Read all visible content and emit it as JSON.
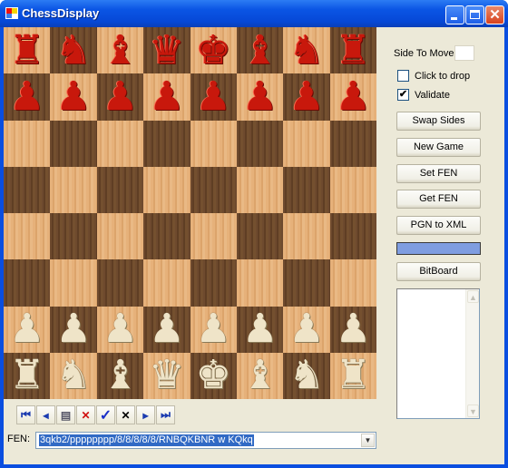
{
  "window": {
    "title": "ChessDisplay",
    "controls": {
      "minimize": "_",
      "maximize": "□",
      "close": "✕"
    }
  },
  "board": {
    "top_left_square": "light",
    "ranks": [
      [
        {
          "piece": "rook",
          "color": "black",
          "glyph": "♜"
        },
        {
          "piece": "knight",
          "color": "black",
          "glyph": "♞"
        },
        {
          "piece": "bishop",
          "color": "black",
          "glyph": "♝"
        },
        {
          "piece": "queen",
          "color": "black",
          "glyph": "♛"
        },
        {
          "piece": "king",
          "color": "black",
          "glyph": "♚"
        },
        {
          "piece": "bishop",
          "color": "black",
          "glyph": "♝"
        },
        {
          "piece": "knight",
          "color": "black",
          "glyph": "♞"
        },
        {
          "piece": "rook",
          "color": "black",
          "glyph": "♜"
        }
      ],
      [
        {
          "piece": "pawn",
          "color": "black",
          "glyph": "♟"
        },
        {
          "piece": "pawn",
          "color": "black",
          "glyph": "♟"
        },
        {
          "piece": "pawn",
          "color": "black",
          "glyph": "♟"
        },
        {
          "piece": "pawn",
          "color": "black",
          "glyph": "♟"
        },
        {
          "piece": "pawn",
          "color": "black",
          "glyph": "♟"
        },
        {
          "piece": "pawn",
          "color": "black",
          "glyph": "♟"
        },
        {
          "piece": "pawn",
          "color": "black",
          "glyph": "♟"
        },
        {
          "piece": "pawn",
          "color": "black",
          "glyph": "♟"
        }
      ],
      [
        null,
        null,
        null,
        null,
        null,
        null,
        null,
        null
      ],
      [
        null,
        null,
        null,
        null,
        null,
        null,
        null,
        null
      ],
      [
        null,
        null,
        null,
        null,
        null,
        null,
        null,
        null
      ],
      [
        null,
        null,
        null,
        null,
        null,
        null,
        null,
        null
      ],
      [
        {
          "piece": "pawn",
          "color": "white",
          "glyph": "♟"
        },
        {
          "piece": "pawn",
          "color": "white",
          "glyph": "♟"
        },
        {
          "piece": "pawn",
          "color": "white",
          "glyph": "♟"
        },
        {
          "piece": "pawn",
          "color": "white",
          "glyph": "♟"
        },
        {
          "piece": "pawn",
          "color": "white",
          "glyph": "♟"
        },
        {
          "piece": "pawn",
          "color": "white",
          "glyph": "♟"
        },
        {
          "piece": "pawn",
          "color": "white",
          "glyph": "♟"
        },
        {
          "piece": "pawn",
          "color": "white",
          "glyph": "♟"
        }
      ],
      [
        {
          "piece": "rook",
          "color": "white",
          "glyph": "♜"
        },
        {
          "piece": "knight",
          "color": "white",
          "glyph": "♞"
        },
        {
          "piece": "bishop",
          "color": "white",
          "glyph": "♝"
        },
        {
          "piece": "queen",
          "color": "white",
          "glyph": "♛"
        },
        {
          "piece": "king",
          "color": "white",
          "glyph": "♚"
        },
        {
          "piece": "bishop",
          "color": "white",
          "glyph": "♝"
        },
        {
          "piece": "knight",
          "color": "white",
          "glyph": "♞"
        },
        {
          "piece": "rook",
          "color": "white",
          "glyph": "♜"
        }
      ]
    ]
  },
  "side_panel": {
    "side_to_move_label": "Side To Move:",
    "side_to_move_value": "",
    "click_to_drop": {
      "label": "Click to drop",
      "checked": false
    },
    "validate": {
      "label": "Validate",
      "checked": true
    },
    "buttons": {
      "swap_sides": "Swap Sides",
      "new_game": "New Game",
      "set_fen": "Set FEN",
      "get_fen": "Get FEN",
      "pgn_to_xml": "PGN to XML",
      "bitboard": "BitBoard"
    },
    "progress": {
      "value_percent": 100,
      "color": "#7f9de0"
    },
    "listbox_items": []
  },
  "toolbar": [
    {
      "name": "first-move-button",
      "glyph": "⏮",
      "icon": "first-icon"
    },
    {
      "name": "previous-move-button",
      "glyph": "◂",
      "icon": "previous-icon"
    },
    {
      "name": "notes-button",
      "glyph": "▤",
      "icon": "notes-icon"
    },
    {
      "name": "delete-button",
      "glyph": "✕",
      "icon": "red-x-icon"
    },
    {
      "name": "accept-button",
      "glyph": "✓",
      "icon": "checkmark-icon"
    },
    {
      "name": "cancel-button",
      "glyph": "✕",
      "icon": "black-x-icon"
    },
    {
      "name": "next-move-button",
      "glyph": "▸",
      "icon": "next-icon"
    },
    {
      "name": "last-move-button",
      "glyph": "⏭",
      "icon": "last-icon"
    }
  ],
  "fen": {
    "label": "FEN:",
    "value": "3qkb2/pppppppp/8/8/8/8/8/RNBQKBNR w KQkq"
  },
  "colors": {
    "title_bar": "#0b55e4",
    "client_bg": "#ece9d8",
    "light_square": "#e6b17a",
    "dark_square": "#6e4a2e",
    "black_piece": "#c8180c",
    "white_piece": "#efe4c8",
    "selection": "#316ac5"
  }
}
